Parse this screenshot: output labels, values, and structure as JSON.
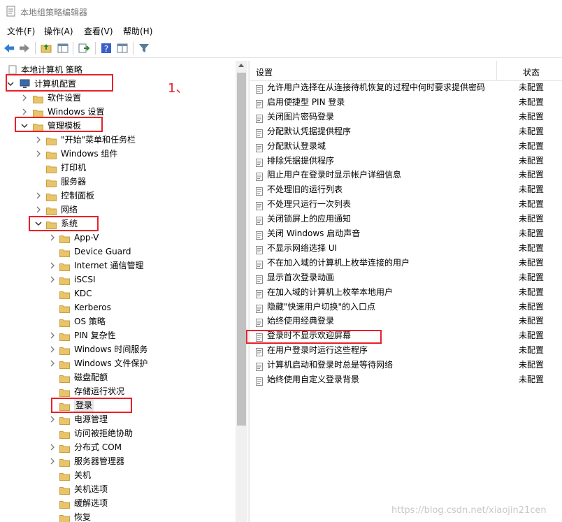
{
  "window": {
    "title": "本地组策略编辑器"
  },
  "menubar": {
    "items": [
      "文件(F)",
      "操作(A)",
      "查看(V)",
      "帮助(H)"
    ]
  },
  "toolbar": {
    "icons": [
      "back-icon",
      "forward-icon",
      "up-folder-icon",
      "show-hide-tree-icon",
      "export-list-icon",
      "help-icon",
      "properties-view-icon",
      "filter-icon"
    ]
  },
  "tree": {
    "root": "本地计算机 策略",
    "computer_config": "计算机配置",
    "software_settings": "软件设置",
    "windows_settings": "Windows 设置",
    "admin_templates": "管理模板",
    "start_menu": "\"开始\"菜单和任务栏",
    "windows_components": "Windows 组件",
    "printers": "打印机",
    "server": "服务器",
    "control_panel": "控制面板",
    "network": "网络",
    "system": "系统",
    "system_children": [
      "App-V",
      "Device Guard",
      "Internet 通信管理",
      "iSCSI",
      "KDC",
      "Kerberos",
      "OS 策略",
      "PIN 复杂性",
      "Windows 时间服务",
      "Windows 文件保护",
      "磁盘配额",
      "存储运行状况",
      "登录",
      "电源管理",
      "访问被拒绝协助",
      "分布式 COM",
      "服务器管理器",
      "关机",
      "关机选项",
      "缓解选项",
      "恢复"
    ]
  },
  "list": {
    "col_setting": "设置",
    "col_state": "状态",
    "rows": [
      {
        "name": "允许用户选择在从连接待机恢复的过程中何时要求提供密码",
        "state": "未配置"
      },
      {
        "name": "启用便捷型 PIN 登录",
        "state": "未配置"
      },
      {
        "name": "关闭图片密码登录",
        "state": "未配置"
      },
      {
        "name": "分配默认凭据提供程序",
        "state": "未配置"
      },
      {
        "name": "分配默认登录域",
        "state": "未配置"
      },
      {
        "name": "排除凭据提供程序",
        "state": "未配置"
      },
      {
        "name": "阻止用户在登录时显示帐户详细信息",
        "state": "未配置"
      },
      {
        "name": "不处理旧的运行列表",
        "state": "未配置"
      },
      {
        "name": "不处理只运行一次列表",
        "state": "未配置"
      },
      {
        "name": "关闭锁屏上的应用通知",
        "state": "未配置"
      },
      {
        "name": "关闭 Windows 启动声音",
        "state": "未配置"
      },
      {
        "name": "不显示网络选择 UI",
        "state": "未配置"
      },
      {
        "name": "不在加入域的计算机上枚举连接的用户",
        "state": "未配置"
      },
      {
        "name": "显示首次登录动画",
        "state": "未配置"
      },
      {
        "name": "在加入域的计算机上枚举本地用户",
        "state": "未配置"
      },
      {
        "name": "隐藏\"快速用户切换\"的入口点",
        "state": "未配置"
      },
      {
        "name": "始终使用经典登录",
        "state": "未配置"
      },
      {
        "name": "登录时不显示欢迎屏幕",
        "state": "未配置"
      },
      {
        "name": "在用户登录时运行这些程序",
        "state": "未配置"
      },
      {
        "name": "计算机启动和登录时总是等待网络",
        "state": "未配置"
      },
      {
        "name": "始终使用自定义登录背景",
        "state": "未配置"
      }
    ]
  },
  "annotation": {
    "step": "1、"
  },
  "watermark": "https://blog.csdn.net/xiaojin21cen",
  "colors": {
    "highlight": "#e8202a",
    "folder": "#e8c46a",
    "selected": "#e5e5e5"
  }
}
